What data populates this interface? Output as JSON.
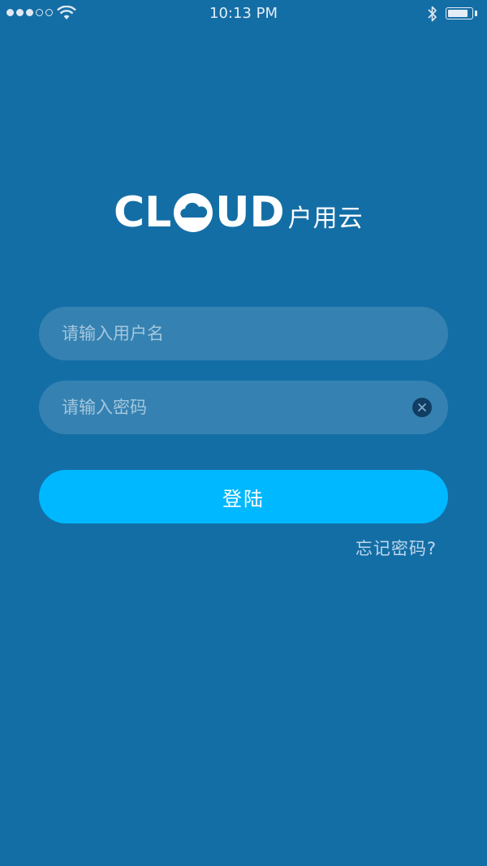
{
  "status_bar": {
    "time": "10:13 PM",
    "signal_bars_filled": 3,
    "signal_bars_total": 5,
    "battery_level": 0.9,
    "icons": [
      "wifi-icon",
      "bluetooth-icon",
      "battery-icon"
    ]
  },
  "logo": {
    "word_before": "CL",
    "word_after": "UD",
    "icon": "cloud-icon",
    "chinese": "户用云"
  },
  "form": {
    "username_placeholder": "请输入用户名",
    "password_placeholder": "请输入密码",
    "clear_icon": "close-circle-icon"
  },
  "login_button": "登陆",
  "forgot_password": "忘记密码?",
  "colors": {
    "background": "#146ea6",
    "field": "rgba(255,255,255,0.14)",
    "button": "#00b8ff",
    "clear_icon_bg": "#103d63",
    "link": "#bcd7ea"
  }
}
